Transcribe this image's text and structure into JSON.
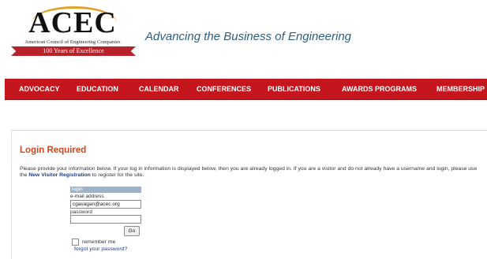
{
  "logo": {
    "name": "ACEC",
    "subtitle": "American Council of Engineering Companies",
    "ribbon": "100 Years of Excellence"
  },
  "tagline": "Advancing the Business of Engineering",
  "nav": {
    "items": [
      "ADVOCACY",
      "EDUCATION",
      "CALENDAR",
      "CONFERENCES",
      "PUBLICATIONS",
      "AWARDS PROGRAMS",
      "MEMBERSHIP"
    ]
  },
  "colors": {
    "nav_bg": "#c4161c",
    "title": "#d0461c",
    "link": "#1c3f8c",
    "tagline": "#2b5e86"
  },
  "login": {
    "title": "Login Required",
    "intro_before": "Please provide your information below. If your log in information is displayed below, then you are already logged in. If you are a visitor and do not already have a username and login, please use the ",
    "intro_link": "New Visitor Registration",
    "intro_after": " to register for the site.",
    "form_header": "login",
    "email_label": "e-mail address",
    "email_value": "cgavagan@acec.org",
    "password_label": "password",
    "password_value": "",
    "go_label": "Go",
    "remember_label": "remember me",
    "remember_checked": false,
    "forgot_link": "forgot your password?"
  }
}
